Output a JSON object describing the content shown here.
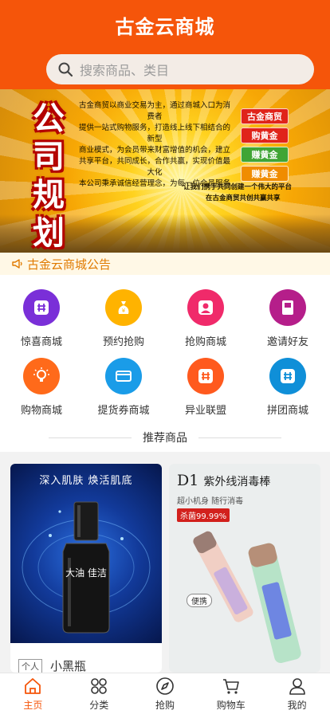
{
  "header": {
    "title": "古金云商城"
  },
  "search": {
    "placeholder": "搜索商品、类目"
  },
  "banner": {
    "chars": [
      "公",
      "司",
      "规",
      "划"
    ],
    "lines": [
      "古金商贸以商业交易为主，通过商城入口为消费者",
      "提供一站式购物服务，打造线上线下相结合的新型",
      "商业模式，为会员带来财富增值的机会，建立",
      "共享平台，共同成长，合作共赢，实现价值最大化",
      "本公司秉承诚信经营理念，为每一位会员服务"
    ],
    "tags": [
      "古金商贸",
      "购黄金",
      "赚黄金",
      "赚黄金"
    ],
    "footer1": "让我们携手共同创建一个伟大的平台",
    "footer2": "在古金商贸共创共赢共享"
  },
  "notice": {
    "text": "古金云商城公告"
  },
  "menu": [
    {
      "label": "惊喜商城",
      "icon": "grid-icon",
      "color": "#7a2fd8"
    },
    {
      "label": "预约抢购",
      "icon": "money-bag-icon",
      "color": "#ffb300"
    },
    {
      "label": "抢购商城",
      "icon": "person-icon",
      "color": "#f02a6a"
    },
    {
      "label": "邀请好友",
      "icon": "book-icon",
      "color": "#b51e8a"
    },
    {
      "label": "购物商城",
      "icon": "bulb-icon",
      "color": "#ff6a1a"
    },
    {
      "label": "提货券商城",
      "icon": "card-icon",
      "color": "#1a9ce8"
    },
    {
      "label": "异业联盟",
      "icon": "grid-icon",
      "color": "#ff5a1e"
    },
    {
      "label": "拼团商城",
      "icon": "grid-icon",
      "color": "#0f8fd8"
    }
  ],
  "section": {
    "title": "推荐商品"
  },
  "products": [
    {
      "badge": "个人",
      "name": "小黑瓶",
      "promo": "深入肌肤 焕活肌底",
      "bottle_text": "大油 佳洁"
    },
    {
      "title_en": "D1",
      "title": "紫外线消毒棒",
      "subtitle": "超小机身 随行消毒",
      "tag": "杀菌99.99%",
      "label": "便携"
    }
  ],
  "tabbar": [
    {
      "label": "主页",
      "icon": "home-icon",
      "active": true
    },
    {
      "label": "分类",
      "icon": "category-icon",
      "active": false
    },
    {
      "label": "抢购",
      "icon": "compass-icon",
      "active": false
    },
    {
      "label": "购物车",
      "icon": "cart-icon",
      "active": false
    },
    {
      "label": "我的",
      "icon": "user-icon",
      "active": false
    }
  ]
}
